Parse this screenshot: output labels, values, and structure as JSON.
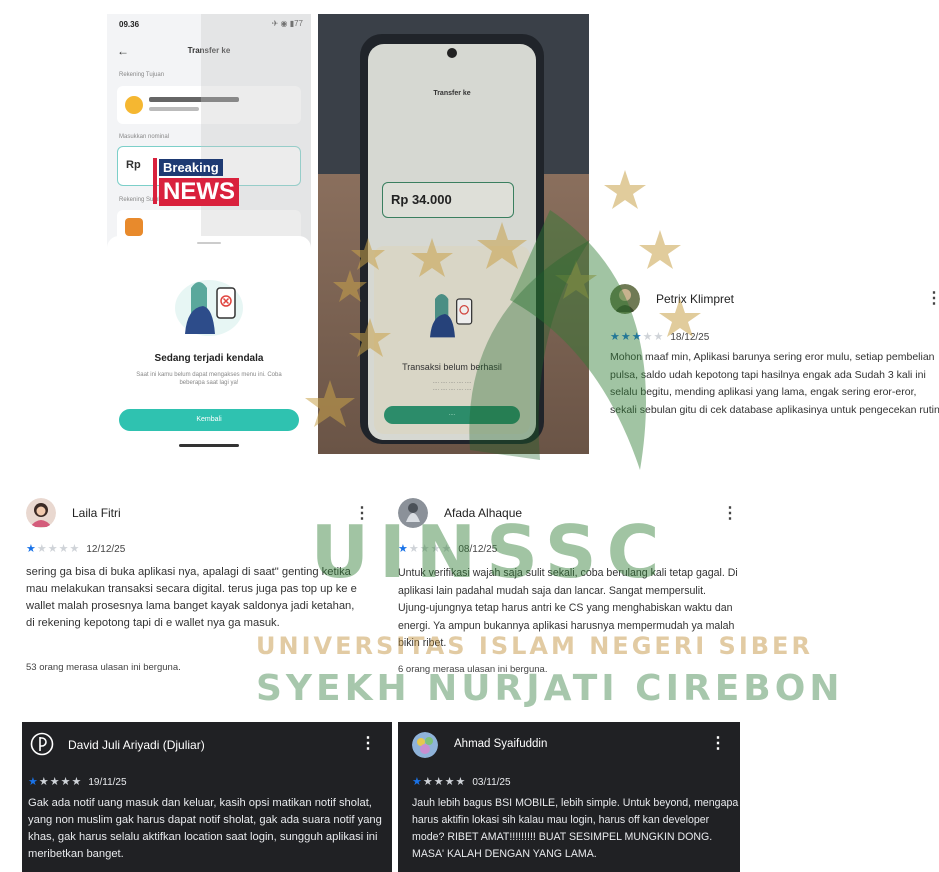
{
  "phone1": {
    "status_time": "09.36",
    "status_battery": "77",
    "header_title": "Transfer ke",
    "label_rekening_tujuan": "Rekening Tujuan",
    "label_masukkan_nominal": "Masukkan nominal",
    "amount_prefix": "Rp",
    "label_rekening_sumber": "Rekening Sumber",
    "news_breaking": "Breaking",
    "news_word": "NEWS",
    "error_title": "Sedang terjadi kendala",
    "error_desc": "Saat ini kamu belum dapat mengakses menu ini. Coba beberapa saat lagi ya!",
    "button_label": "Kembali"
  },
  "photo2": {
    "header_title": "Transfer ke",
    "amount": "Rp 34.000",
    "error_title": "Transaksi belum berhasil"
  },
  "reviews": {
    "petrix": {
      "name": "Petrix Klimpret",
      "stars": 3,
      "date": "18/12/25",
      "text": "Mohon maaf min, Aplikasi barunya sering eror mulu, setiap pembelian pulsa, saldo udah kepotong tapi hasilnya engak ada Sudah 3 kali ini selalu begitu, mending aplikasi yang lama, engak sering eror-eror, sekali sebulan gitu di cek database aplikasinya untuk pengecekan rutin"
    },
    "laila": {
      "name": "Laila Fitri",
      "stars": 1,
      "date": "12/12/25",
      "text": "sering ga bisa di buka aplikasi nya, apalagi di saat\" genting ketika mau melakukan transaksi secara digital. terus juga pas top up ke e wallet malah prosesnya lama banget kayak saldonya jadi ketahan, di rekening kepotong tapi di e wallet nya ga masuk.",
      "helpful": "53 orang merasa ulasan ini berguna."
    },
    "afada": {
      "name": "Afada Alhaque",
      "stars": 1,
      "date": "08/12/25",
      "text": "Untuk verifikasi wajah saja sulit sekali, coba berulang kali tetap gagal. Di aplikasi lain padahal mudah saja dan lancar. Sangat mempersulit. Ujung-ujungnya tetap harus antri ke CS yang menghabiskan waktu dan energi. Ya ampun bukannya aplikasi harusnya mempermudah ya malah bikin ribet.",
      "helpful": "6 orang merasa ulasan ini berguna."
    },
    "david": {
      "name": "David Juli Ariyadi (Djuliar)",
      "stars": 1,
      "date": "19/11/25",
      "text": "Gak ada notif uang masuk dan keluar, kasih opsi matikan notif sholat, yang non muslim gak harus dapat notif sholat, gak ada suara notif yang khas, gak harus selalu aktifkan location saat login, sungguh aplikasi ini meribetkan banget."
    },
    "ahmad": {
      "name": "Ahmad Syaifuddin",
      "stars": 1,
      "date": "03/11/25",
      "text": "Jauh lebih bagus BSI MOBILE, lebih simple. Untuk beyond, mengapa harus aktifin lokasi sih kalau mau login, harus off kan developer mode? RIBET AMAT!!!!!!!!! BUAT SESIMPEL MUNGKIN DONG. MASA' KALAH DENGAN YANG LAMA."
    }
  },
  "watermark": {
    "big": "UINSSC",
    "line1": "UNIVERSITAS ISLAM NEGERI SIBER",
    "line2": "SYEKH NURJATI CIREBON"
  },
  "colors": {
    "star_on": "#1a73e8",
    "star_off": "#cfd3d8",
    "primary_teal": "#2fc2b0",
    "dark_card": "#202124",
    "watermark_green": "#2e7d32",
    "watermark_gold": "#c9a24a"
  }
}
